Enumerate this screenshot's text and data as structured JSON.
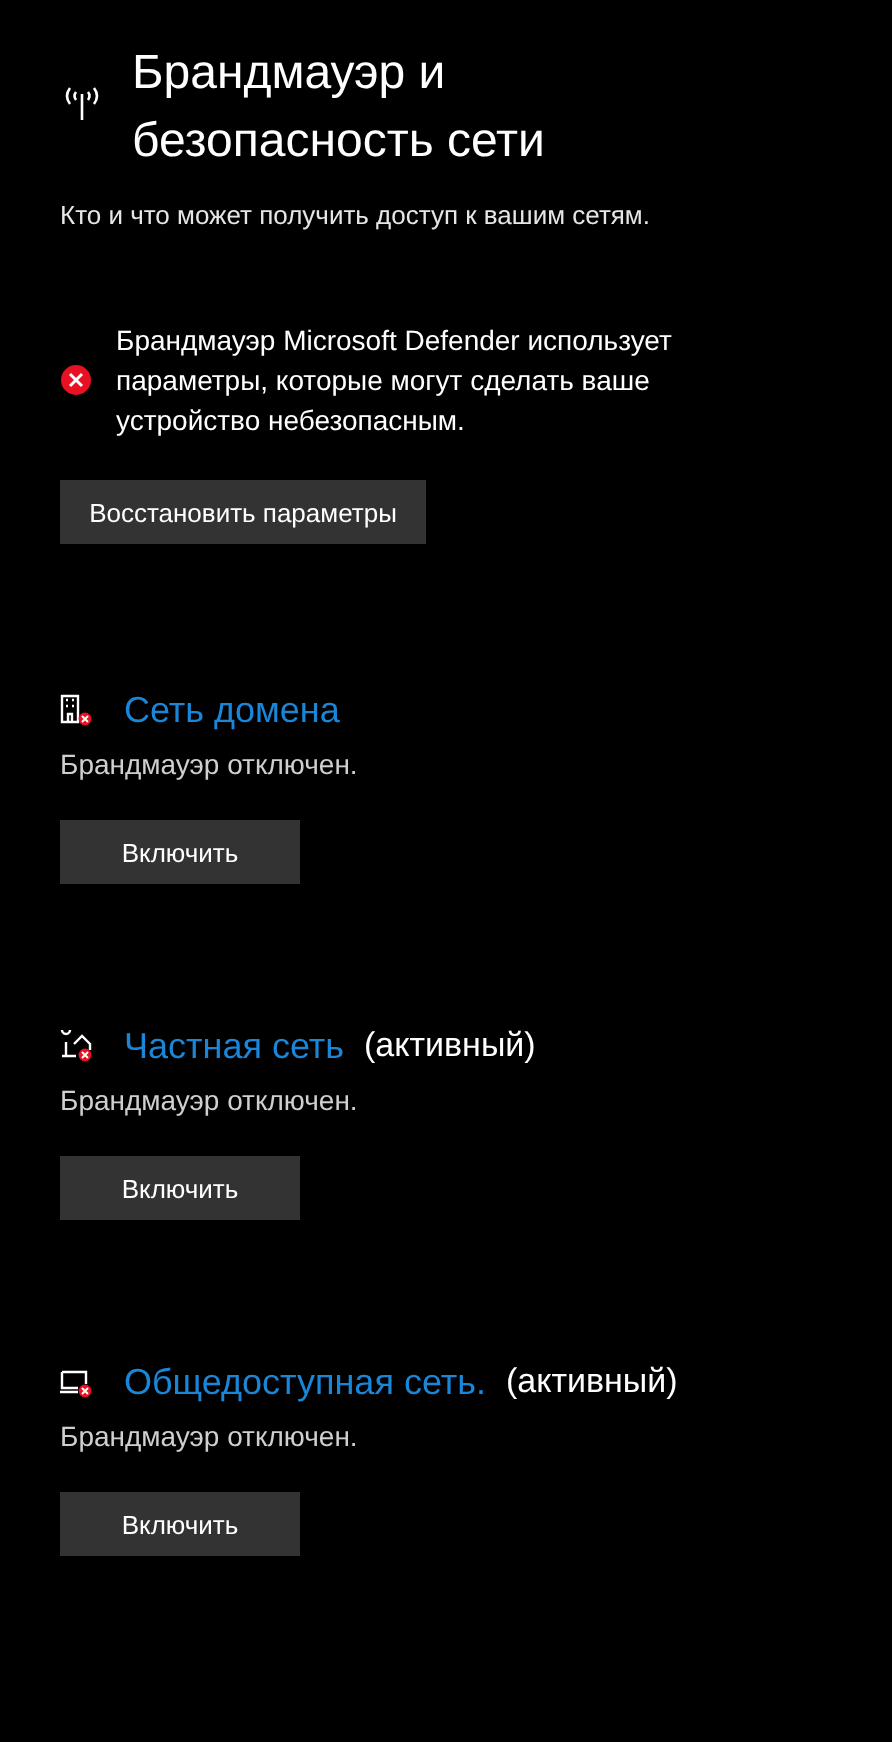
{
  "title": "Брандмауэр и безопасность сети",
  "subtitle": "Кто и что может получить доступ к вашим сетям.",
  "warning": {
    "text": "Брандмауэр Microsoft Defender использует параметры, которые могут сделать ваше устройство небезопасным.",
    "button": "Восстановить параметры"
  },
  "networks": [
    {
      "kind": "domain",
      "name": "Сеть домена",
      "status": "Брандмауэр отключен.",
      "button": "Включить"
    },
    {
      "kind": "private",
      "name": "Частная сеть",
      "active": "(активный)",
      "status": "Брандмауэр отключен.",
      "button": "Включить"
    },
    {
      "kind": "public",
      "name": "Общедоступная сеть.",
      "active": "(активный)",
      "status": "Брандмауэр отключен.",
      "button": "Включить"
    }
  ]
}
